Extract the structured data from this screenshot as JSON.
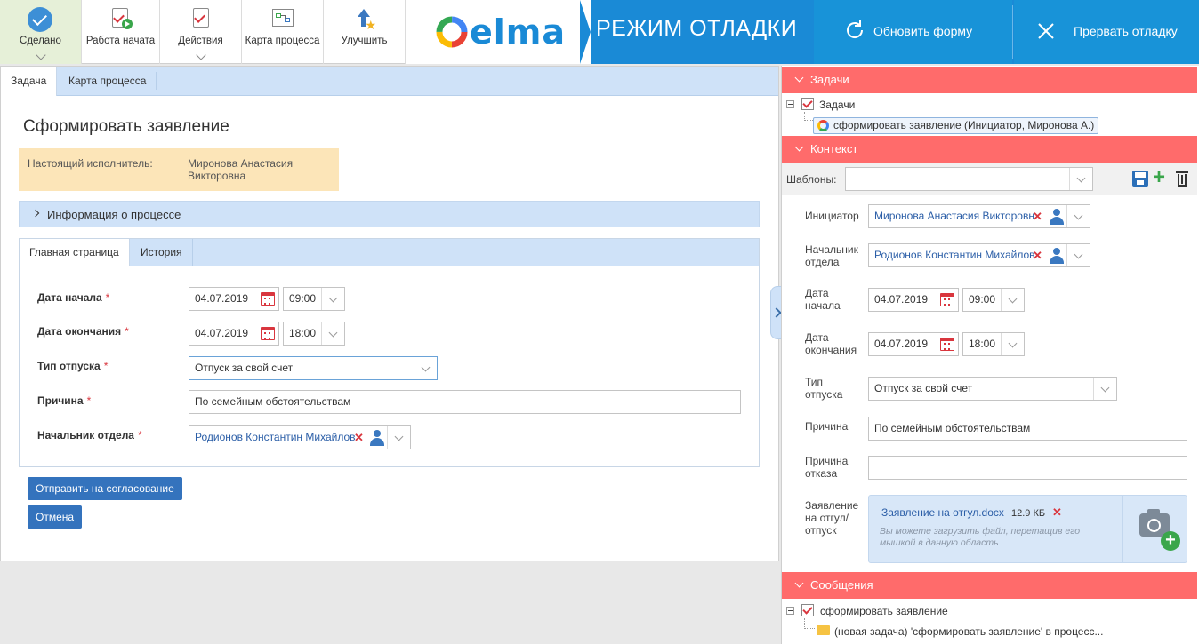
{
  "toolbar": {
    "done_label": "Сделано",
    "work_started_label": "Работа начата",
    "actions_label": "Действия",
    "process_map_label": "Карта процесса",
    "improve_label": "Улучшить"
  },
  "header": {
    "logo_text": "elma",
    "debug_mode_label": "РЕЖИМ ОТЛАДКИ",
    "refresh_form_label": "Обновить форму",
    "abort_debug_label": "Прервать отладку"
  },
  "tabs": [
    {
      "label": "Задача"
    },
    {
      "label": "Карта процесса"
    }
  ],
  "task": {
    "title": "Сформировать заявление",
    "executor_label": "Настоящий исполнитель:",
    "executor_name": "Миронова Анастасия Викторовна",
    "process_info_label": "Информация о процессе"
  },
  "inner_tabs": [
    {
      "label": "Главная страница"
    },
    {
      "label": "История"
    }
  ],
  "form": {
    "start_date_label": "Дата начала",
    "start_date": "04.07.2019",
    "start_time": "09:00",
    "end_date_label": "Дата окончания",
    "end_date": "04.07.2019",
    "end_time": "18:00",
    "leave_type_label": "Тип отпуска",
    "leave_type": "Отпуск за свой счет",
    "reason_label": "Причина",
    "reason": "По семейным обстоятельствам",
    "department_head_label": "Начальник отдела",
    "department_head": "Родионов Константин Михайлов",
    "required_mark": "*"
  },
  "buttons": {
    "send_approval": "Отправить на согласование",
    "cancel": "Отмена"
  },
  "right": {
    "tasks_header": "Задачи",
    "tasks_root": "Задачи",
    "task_item": "сформировать заявление (Инициатор, Миронова А.)",
    "context_header": "Контекст",
    "templates_label": "Шаблоны:",
    "initiator_label": "Инициатор",
    "initiator_value": "Миронова Анастасия Викторовна",
    "dept_head_label": "Начальник отдела",
    "dept_head_value": "Родионов Константин Михайлов",
    "start_date_label": "Дата начала",
    "start_date": "04.07.2019",
    "start_time": "09:00",
    "end_date_label": "Дата окончания",
    "end_date": "04.07.2019",
    "end_time": "18:00",
    "leave_type_label": "Тип отпуска",
    "leave_type": "Отпуск за свой счет",
    "reason_label": "Причина",
    "reason": "По семейным обстоятельствам",
    "refusal_reason_label": "Причина отказа",
    "refusal_reason": "",
    "application_label": "Заявление на отгул/ отпуск",
    "file_name": "Заявление на отгул.docx",
    "file_size": "12.9 КБ",
    "drop_hint": "Вы можете загрузить файл, перетащив его мышкой в данную область",
    "messages_header": "Сообщения",
    "msg_root": "сформировать заявление",
    "msg_item": "(новая задача) 'сформировать заявление' в процесс..."
  },
  "colors": {
    "accent_blue": "#1a8ad6",
    "header_red": "#ff6b6b",
    "button_blue": "#3473bd",
    "executor_bg": "#fce5b8"
  }
}
